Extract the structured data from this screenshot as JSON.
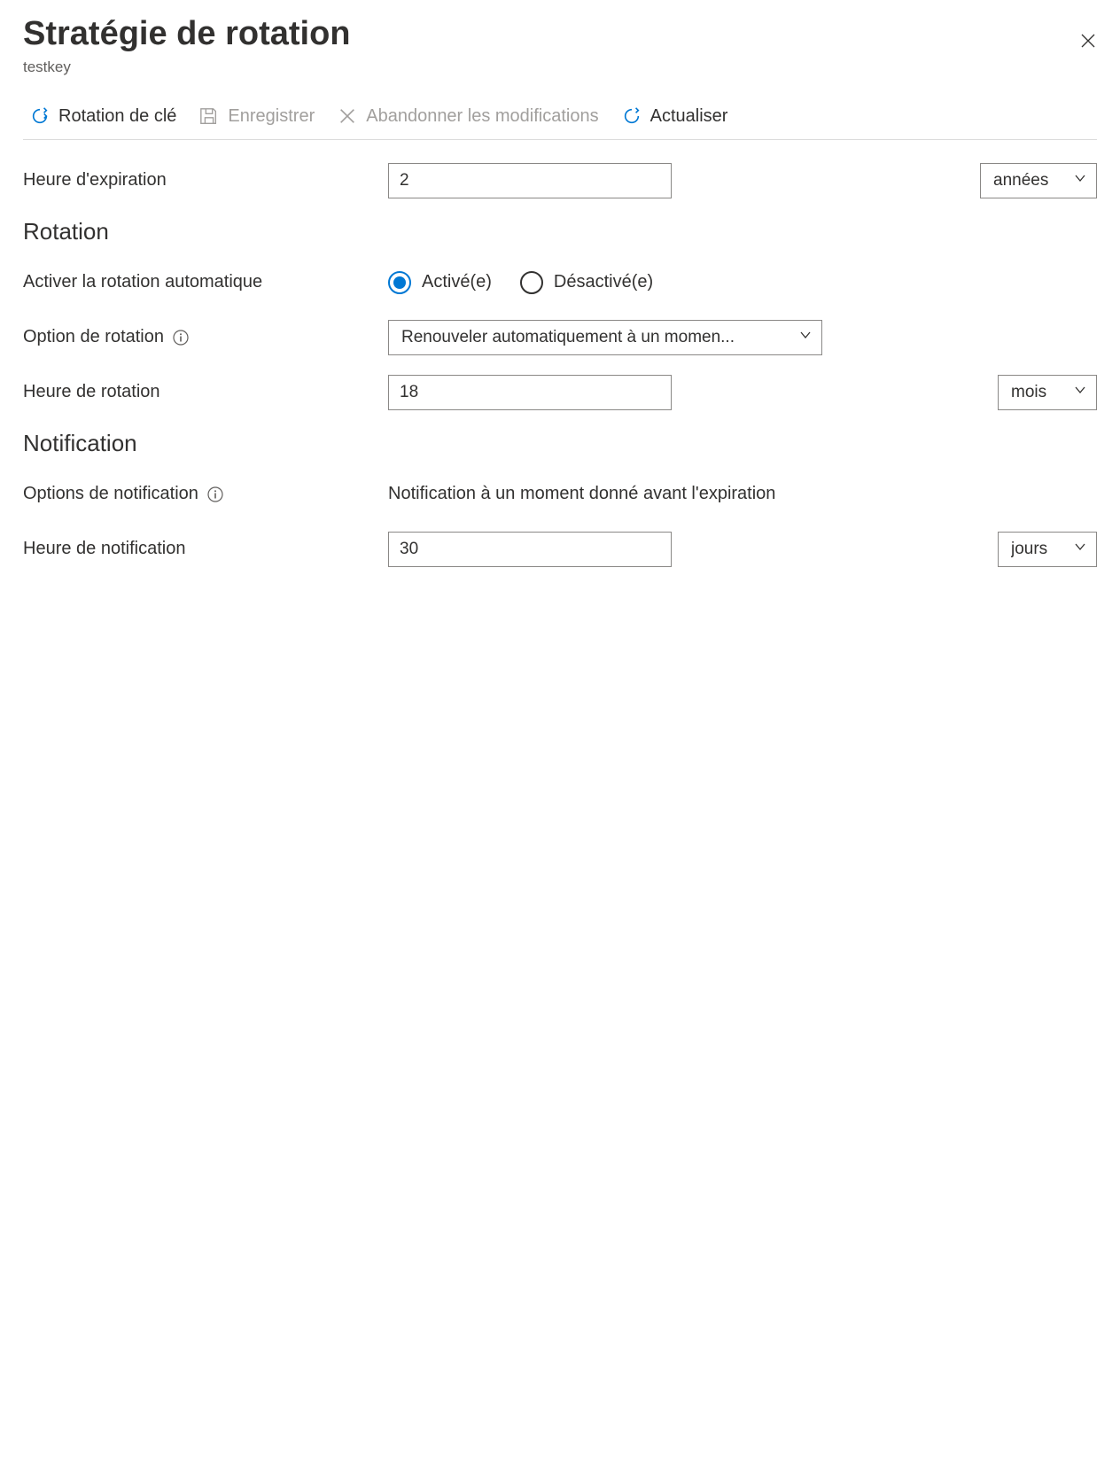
{
  "header": {
    "title": "Stratégie de rotation",
    "subtitle": "testkey"
  },
  "toolbar": {
    "keyRotation": "Rotation de clé",
    "save": "Enregistrer",
    "discard": "Abandonner les modifications",
    "refresh": "Actualiser"
  },
  "expiration": {
    "label": "Heure d'expiration",
    "value": "2",
    "unit": "années"
  },
  "rotation": {
    "heading": "Rotation",
    "autoLabel": "Activer la rotation automatique",
    "optEnabled": "Activé(e)",
    "optDisabled": "Désactivé(e)",
    "optionLabel": "Option de rotation",
    "optionValue": "Renouveler automatiquement à un momen...",
    "timeLabel": "Heure de rotation",
    "timeValue": "18",
    "timeUnit": "mois"
  },
  "notification": {
    "heading": "Notification",
    "optionsLabel": "Options de notification",
    "optionsText": "Notification à un moment donné avant l'expiration",
    "timeLabel": "Heure de notification",
    "timeValue": "30",
    "timeUnit": "jours"
  }
}
